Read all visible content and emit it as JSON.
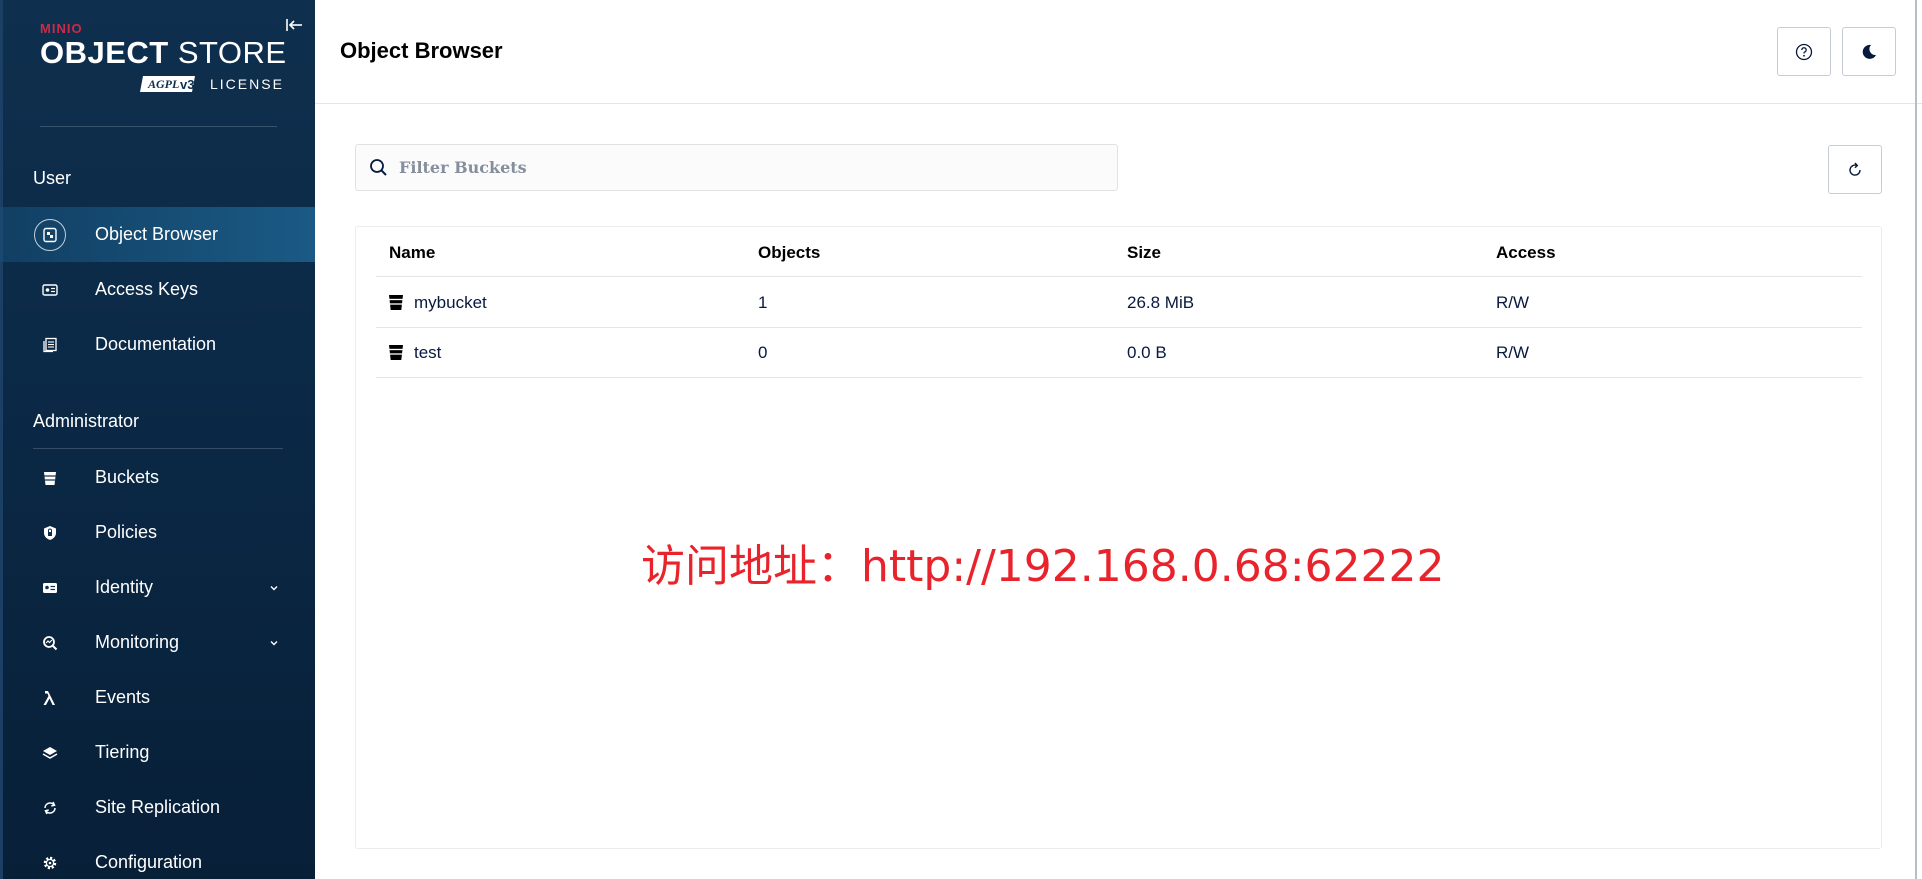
{
  "brand": {
    "minio": "MINIO",
    "product_bold": "OBJECT",
    "product_light": "STORE",
    "license_badge": "AGPLv3",
    "license": "LICENSE"
  },
  "sidebar": {
    "user_section": "User",
    "user_items": [
      {
        "label": "Object Browser",
        "icon": "object-browser-icon",
        "active": true
      },
      {
        "label": "Access Keys",
        "icon": "access-keys-icon"
      },
      {
        "label": "Documentation",
        "icon": "documentation-icon"
      }
    ],
    "admin_section": "Administrator",
    "admin_items": [
      {
        "label": "Buckets",
        "icon": "bucket-icon"
      },
      {
        "label": "Policies",
        "icon": "shield-icon"
      },
      {
        "label": "Identity",
        "icon": "identity-icon",
        "expandable": true
      },
      {
        "label": "Monitoring",
        "icon": "monitoring-icon",
        "expandable": true
      },
      {
        "label": "Events",
        "icon": "lambda-icon"
      },
      {
        "label": "Tiering",
        "icon": "layers-icon"
      },
      {
        "label": "Site Replication",
        "icon": "replication-icon"
      },
      {
        "label": "Configuration",
        "icon": "gear-icon"
      }
    ]
  },
  "header": {
    "title": "Object Browser",
    "help_icon": "help-icon",
    "theme_icon": "moon-icon"
  },
  "main": {
    "search_placeholder": "Filter Buckets",
    "search_value": "",
    "columns": [
      "Name",
      "Objects",
      "Size",
      "Access"
    ],
    "rows": [
      {
        "name": "mybucket",
        "objects": "1",
        "size": "26.8 MiB",
        "access": "R/W"
      },
      {
        "name": "test",
        "objects": "0",
        "size": "0.0 B",
        "access": "R/W"
      }
    ]
  },
  "overlay": {
    "text": "访问地址：http://192.168.0.68:62222"
  },
  "colors": {
    "sidebar_bg": "#0f2f4e",
    "active_item": "#1a5a85",
    "brand_red": "#c72c48",
    "overlay_red": "#e8232b"
  }
}
